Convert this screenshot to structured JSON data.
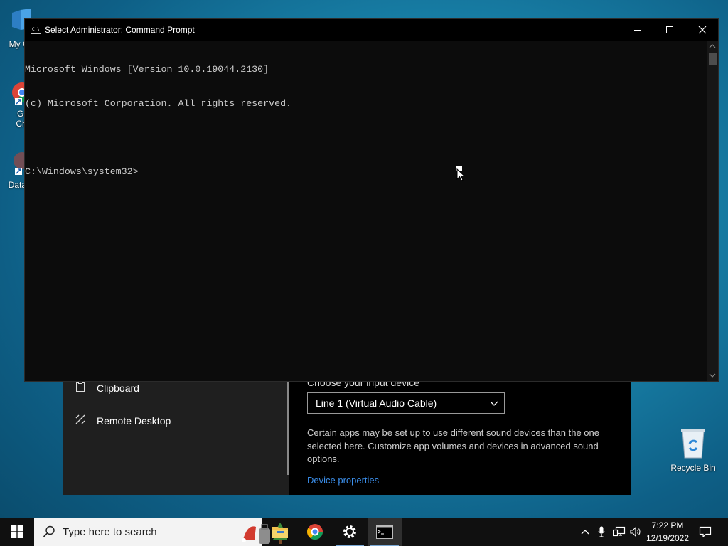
{
  "desktop": {
    "icons": [
      {
        "label": "My Co"
      },
      {
        "label": "Go\nChr"
      },
      {
        "label": "DataW"
      },
      {
        "label": "Recycle Bin"
      }
    ]
  },
  "settings": {
    "nav": [
      {
        "label": "Clipboard",
        "icon": "clipboard-icon"
      },
      {
        "label": "Remote Desktop",
        "icon": "remote-desktop-icon"
      }
    ],
    "input_label": "Choose your input device",
    "input_device": "Line 1 (Virtual Audio Cable)",
    "description": "Certain apps may be set up to use different sound devices than the one selected here. Customize app volumes and devices in advanced sound options.",
    "device_properties": "Device properties"
  },
  "cmd": {
    "title": "Select Administrator: Command Prompt",
    "lines": [
      "Microsoft Windows [Version 10.0.19044.2130]",
      "(c) Microsoft Corporation. All rights reserved.",
      "",
      "C:\\Windows\\system32>"
    ]
  },
  "taskbar": {
    "search_placeholder": "Type here to search",
    "time": "7:22 PM",
    "date": "12/19/2022"
  },
  "colors": {
    "link": "#3b8eea",
    "console_text": "#cccccc",
    "console_bg": "#0c0c0c"
  }
}
